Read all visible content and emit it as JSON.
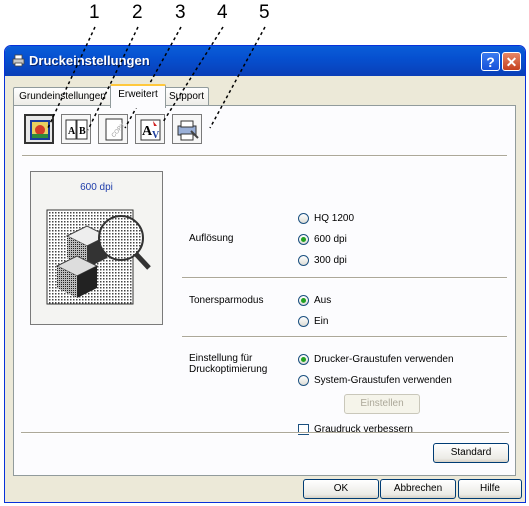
{
  "callouts": [
    "1",
    "2",
    "3",
    "4",
    "5"
  ],
  "window": {
    "title": "Druckeinstellungen",
    "help_button": "?",
    "close_button": "✕"
  },
  "tabs": [
    {
      "label": "Grundeinstellungen",
      "active": false
    },
    {
      "label": "Erweitert",
      "active": true
    },
    {
      "label": "Support",
      "active": false
    }
  ],
  "toolbar_icons": [
    {
      "name": "print-quality-icon",
      "selected": true
    },
    {
      "name": "duplex-icon",
      "selected": false
    },
    {
      "name": "watermark-icon",
      "selected": false
    },
    {
      "name": "page-setting-icon",
      "selected": false
    },
    {
      "name": "device-options-icon",
      "selected": false
    }
  ],
  "preview": {
    "label": "600 dpi"
  },
  "resolution": {
    "label": "Auflösung",
    "options": [
      {
        "label": "HQ 1200",
        "selected": false
      },
      {
        "label": "600 dpi",
        "selected": true
      },
      {
        "label": "300 dpi",
        "selected": false
      }
    ]
  },
  "toner_save": {
    "label": "Tonersparmodus",
    "options": [
      {
        "label": "Aus",
        "selected": true
      },
      {
        "label": "Ein",
        "selected": false
      }
    ]
  },
  "print_optimization": {
    "label_line1": "Einstellung für",
    "label_line2": "Druckoptimierung",
    "options": [
      {
        "label": "Drucker-Graustufen verwenden",
        "selected": true
      },
      {
        "label": "System-Graustufen verwenden",
        "selected": false
      }
    ],
    "settings_button": "Einstellen",
    "grayscale_checkbox": {
      "label": "Graudruck verbessern",
      "checked": false
    }
  },
  "buttons": {
    "standard": "Standard",
    "ok": "OK",
    "cancel": "Abbrechen",
    "help": "Hilfe"
  },
  "colors": {
    "titlebar": "#0a5dd8",
    "accent_tab": "#ffc83c",
    "preview_label": "#1e3caa"
  }
}
